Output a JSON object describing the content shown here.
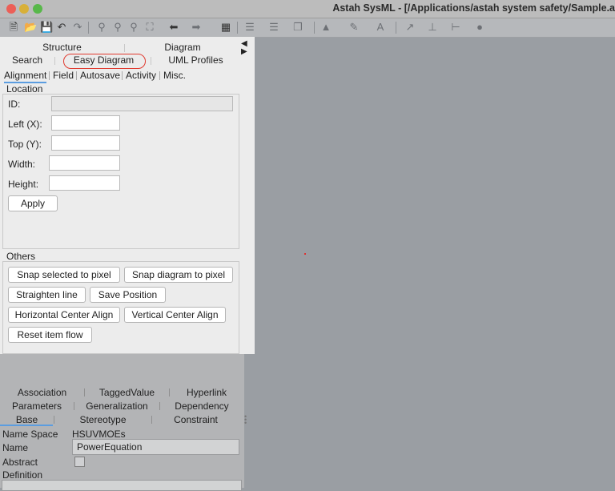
{
  "window": {
    "title": "Astah SysML - [/Applications/astah system safety/Sample.a"
  },
  "toolbar": {
    "icons": [
      "new-file-icon",
      "open-folder-icon",
      "save-icon",
      "undo-icon",
      "redo-icon",
      "zoom-icon",
      "zoom-in-icon",
      "zoom-out-icon",
      "fit-icon",
      "back-icon",
      "forward-icon",
      "grid-icon",
      "align-icon",
      "arrange-icon",
      "layer-icon",
      "fill-icon",
      "pen-icon",
      "font-icon",
      "line-icon",
      "tree-icon",
      "route-icon",
      "color-icon"
    ]
  },
  "panel": {
    "tabs_row1": [
      "Structure",
      "Diagram"
    ],
    "tabs_row2": [
      "Search",
      "Easy Diagram",
      "UML Profiles"
    ],
    "subtabs": [
      "Alignment",
      "Field",
      "Autosave",
      "Activity",
      "Misc."
    ],
    "active_subtab": "Alignment",
    "location": {
      "title": "Location",
      "id_label": "ID:",
      "left_label": "Left (X):",
      "top_label": "Top (Y):",
      "width_label": "Width:",
      "height_label": "Height:",
      "id_value": "",
      "left_value": "",
      "top_value": "",
      "width_value": "",
      "height_value": "",
      "apply": "Apply"
    },
    "others": {
      "title": "Others",
      "snap_selected": "Snap selected to pixel",
      "snap_diagram": "Snap diagram to pixel",
      "straighten": "Straighten line",
      "save_position": "Save Position",
      "h_center": "Horizontal Center Align",
      "v_center": "Vertical Center Align",
      "reset_flow": "Reset item flow"
    }
  },
  "properties": {
    "tabs_row1": [
      "Association",
      "TaggedValue",
      "Hyperlink"
    ],
    "tabs_row2": [
      "Parameters",
      "Generalization",
      "Dependency"
    ],
    "tabs_row3": [
      "Base",
      "Stereotype",
      "Constraint"
    ],
    "active_tab": "Base",
    "namespace_label": "Name Space",
    "namespace_value": "HSUVMOEs",
    "name_label": "Name",
    "name_value": "PowerEquation",
    "abstract_label": "Abstract",
    "abstract_checked": false,
    "definition_label": "Definition"
  },
  "colors": {
    "highlight_ring": "#e0392e",
    "active_tab_underline": "#5b9de0",
    "canvas": "#9a9ea3"
  }
}
